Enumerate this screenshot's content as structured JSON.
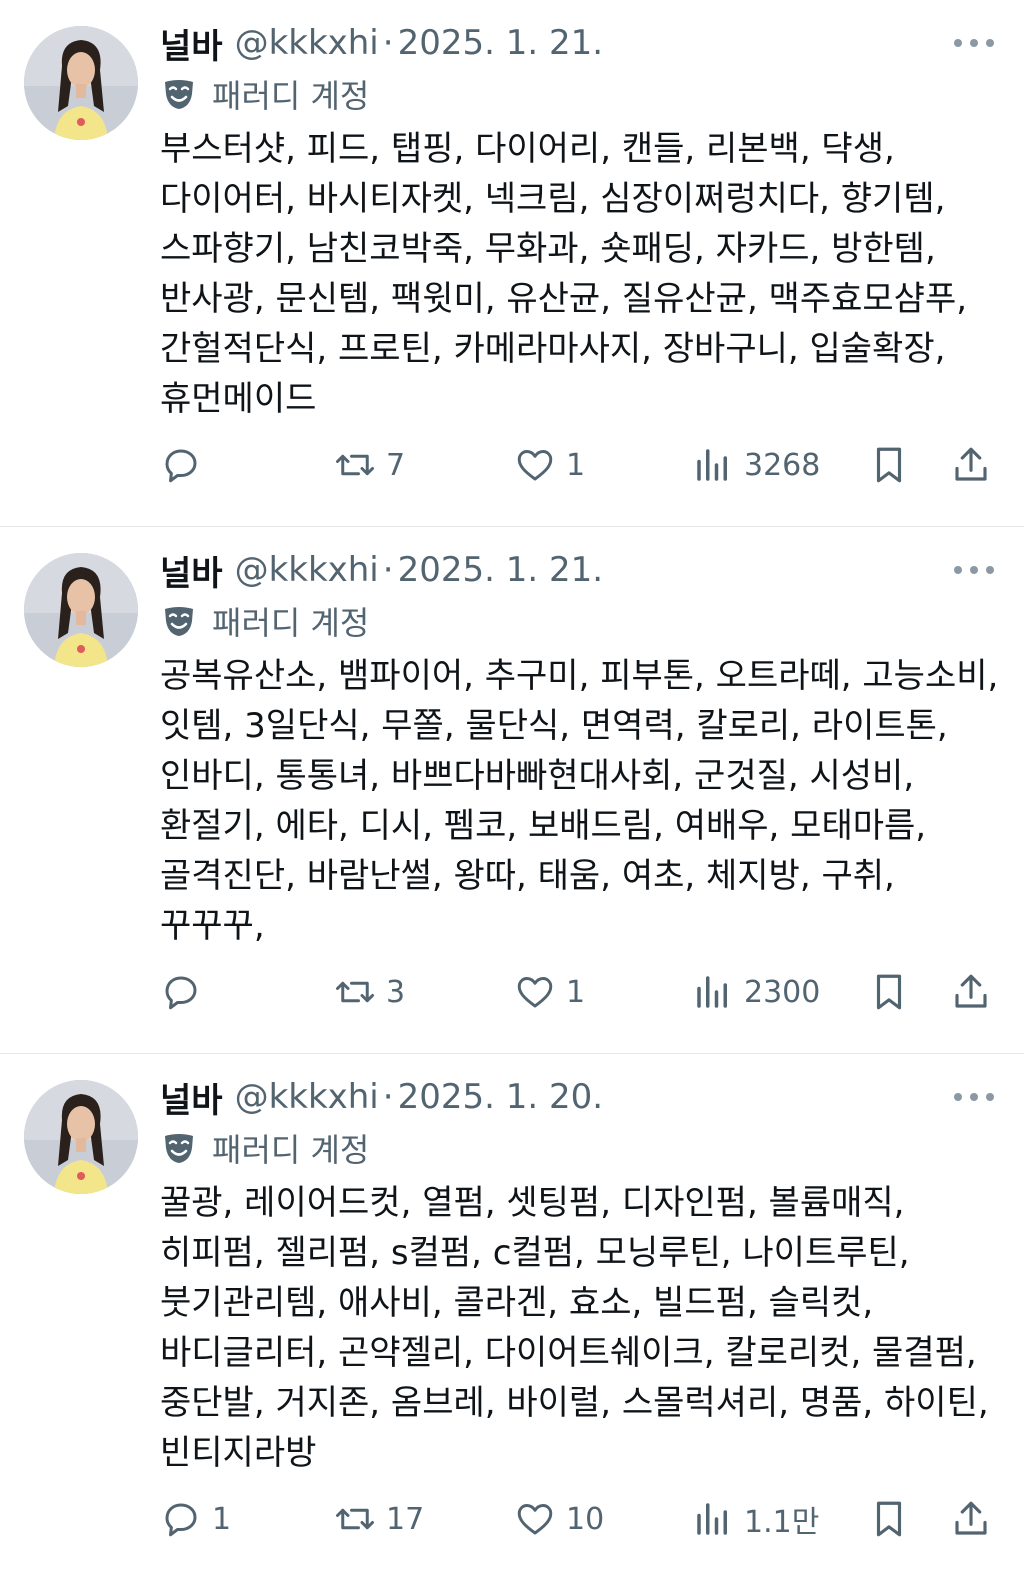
{
  "colors": {
    "text": "#0f1419",
    "secondary": "#536471",
    "divider": "#e6e9ec"
  },
  "icons": {
    "reply": "speech-bubble-icon",
    "retweet": "retweet-icon",
    "like": "heart-icon",
    "views": "bar-chart-icon",
    "bookmark": "bookmark-icon",
    "share": "share-upload-icon",
    "more": "three-dots-icon",
    "parody": "theater-mask-icon"
  },
  "tweets": [
    {
      "name": "널바",
      "handle": "@kkkxhi",
      "dot": "·",
      "date": "2025. 1. 21.",
      "parody_label": "패러디 계정",
      "text": "부스터샷, 피드, 탭핑, 다이어리, 캔들, 리본백, 댝생, 다이어터, 바시티자켓, 넥크림, 심장이쩌렁치다, 향기템, 스파향기, 남친코박죽, 무화과, 숏패딩, 자카드, 방한템, 반사광, 문신템, 팩윗미, 유산균, 질유산균, 맥주효모샴푸, 간헐적단식, 프로틴, 카메라마사지, 장바구니, 입술확장, 휴먼메이드",
      "replies": "",
      "retweets": "7",
      "likes": "1",
      "views": "3268"
    },
    {
      "name": "널바",
      "handle": "@kkkxhi",
      "dot": "·",
      "date": "2025. 1. 21.",
      "parody_label": "패러디 계정",
      "text": "공복유산소, 뱀파이어, 추구미, 피부톤, 오트라떼, 고능소비, 잇템, 3일단식, 무쫄, 물단식, 면역력, 칼로리, 라이트톤, 인바디, 통통녀, 바쁘다바빠현대사회, 군것질, 시성비, 환절기, 에타, 디시, 펨코, 보배드림, 여배우, 모태마름, 골격진단, 바람난썰, 왕따, 태움, 여초, 체지방, 구취, 꾸꾸꾸,",
      "replies": "",
      "retweets": "3",
      "likes": "1",
      "views": "2300"
    },
    {
      "name": "널바",
      "handle": "@kkkxhi",
      "dot": "·",
      "date": "2025. 1. 20.",
      "parody_label": "패러디 계정",
      "text": "꿀광, 레이어드컷, 열펌, 셋팅펌, 디자인펌, 볼륨매직, 히피펌, 젤리펌, s컬펌, c컬펌, 모닝루틴, 나이트루틴, 붓기관리템, 애사비, 콜라겐, 효소, 빌드펌, 슬릭컷, 바디글리터, 곤약젤리, 다이어트쉐이크, 칼로리컷, 물결펌, 중단발, 거지존, 옴브레, 바이럴, 스몰럭셔리, 명품, 하이틴, 빈티지라방",
      "replies": "1",
      "retweets": "17",
      "likes": "10",
      "views": "1.1만"
    }
  ]
}
